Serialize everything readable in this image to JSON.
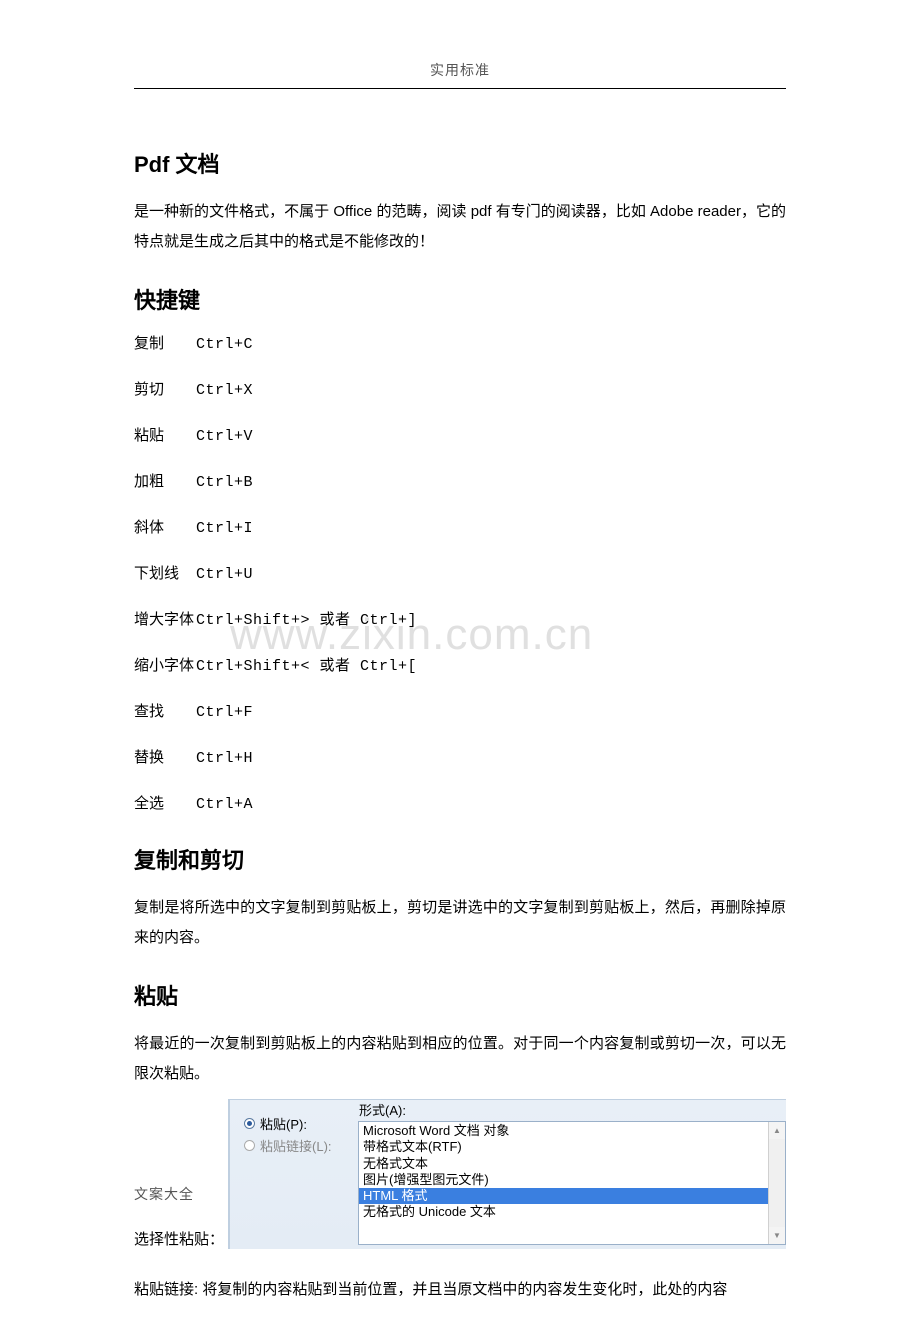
{
  "header": {
    "title": "实用标准"
  },
  "footer": {
    "text": "文案大全"
  },
  "watermark": "www.zixin.com.cn",
  "sections": {
    "pdf": {
      "heading": "Pdf 文档",
      "body": "是一种新的文件格式，不属于 Office 的范畴，阅读 pdf 有专门的阅读器，比如 Adobe reader，它的特点就是生成之后其中的格式是不能修改的！"
    },
    "shortcuts": {
      "heading": "快捷键",
      "rows": [
        {
          "label": "复制",
          "key": "Ctrl+C"
        },
        {
          "label": "剪切",
          "key": "Ctrl+X"
        },
        {
          "label": "粘贴",
          "key": "Ctrl+V"
        },
        {
          "label": "加粗",
          "key": "Ctrl+B"
        },
        {
          "label": "斜体",
          "key": "Ctrl+I"
        },
        {
          "label": "下划线",
          "key": "Ctrl+U"
        },
        {
          "label": "增大字体",
          "key": "Ctrl+Shift+>   或者   Ctrl+]"
        },
        {
          "label": "缩小字体",
          "key": "Ctrl+Shift+<   或者   Ctrl+["
        },
        {
          "label": "查找",
          "key": "Ctrl+F"
        },
        {
          "label": "替换",
          "key": "Ctrl+H"
        },
        {
          "label": "全选",
          "key": "Ctrl+A"
        }
      ]
    },
    "copycut": {
      "heading": "复制和剪切",
      "body": "复制是将所选中的文字复制到剪贴板上，剪切是讲选中的文字复制到剪贴板上，然后，再删除掉原来的内容。"
    },
    "paste": {
      "heading": "粘贴",
      "body": "将最近的一次复制到剪贴板上的内容粘贴到相应的位置。对于同一个内容复制或剪切一次，可以无限次粘贴。",
      "selective_label": "选择性粘贴：",
      "link_para": "粘贴链接: 将复制的内容粘贴到当前位置，并且当原文档中的内容发生变化时，此处的内容"
    }
  },
  "dialog": {
    "format_label": "形式(A):",
    "radios": [
      {
        "label": "粘贴(P):",
        "selected": true,
        "enabled": true
      },
      {
        "label": "粘贴链接(L):",
        "selected": false,
        "enabled": false
      }
    ],
    "list": [
      {
        "text": "Microsoft Word 文档 对象",
        "selected": false
      },
      {
        "text": "带格式文本(RTF)",
        "selected": false
      },
      {
        "text": "无格式文本",
        "selected": false
      },
      {
        "text": "图片(增强型图元文件)",
        "selected": false
      },
      {
        "text": "HTML 格式",
        "selected": true
      },
      {
        "text": "无格式的 Unicode 文本",
        "selected": false
      }
    ]
  }
}
